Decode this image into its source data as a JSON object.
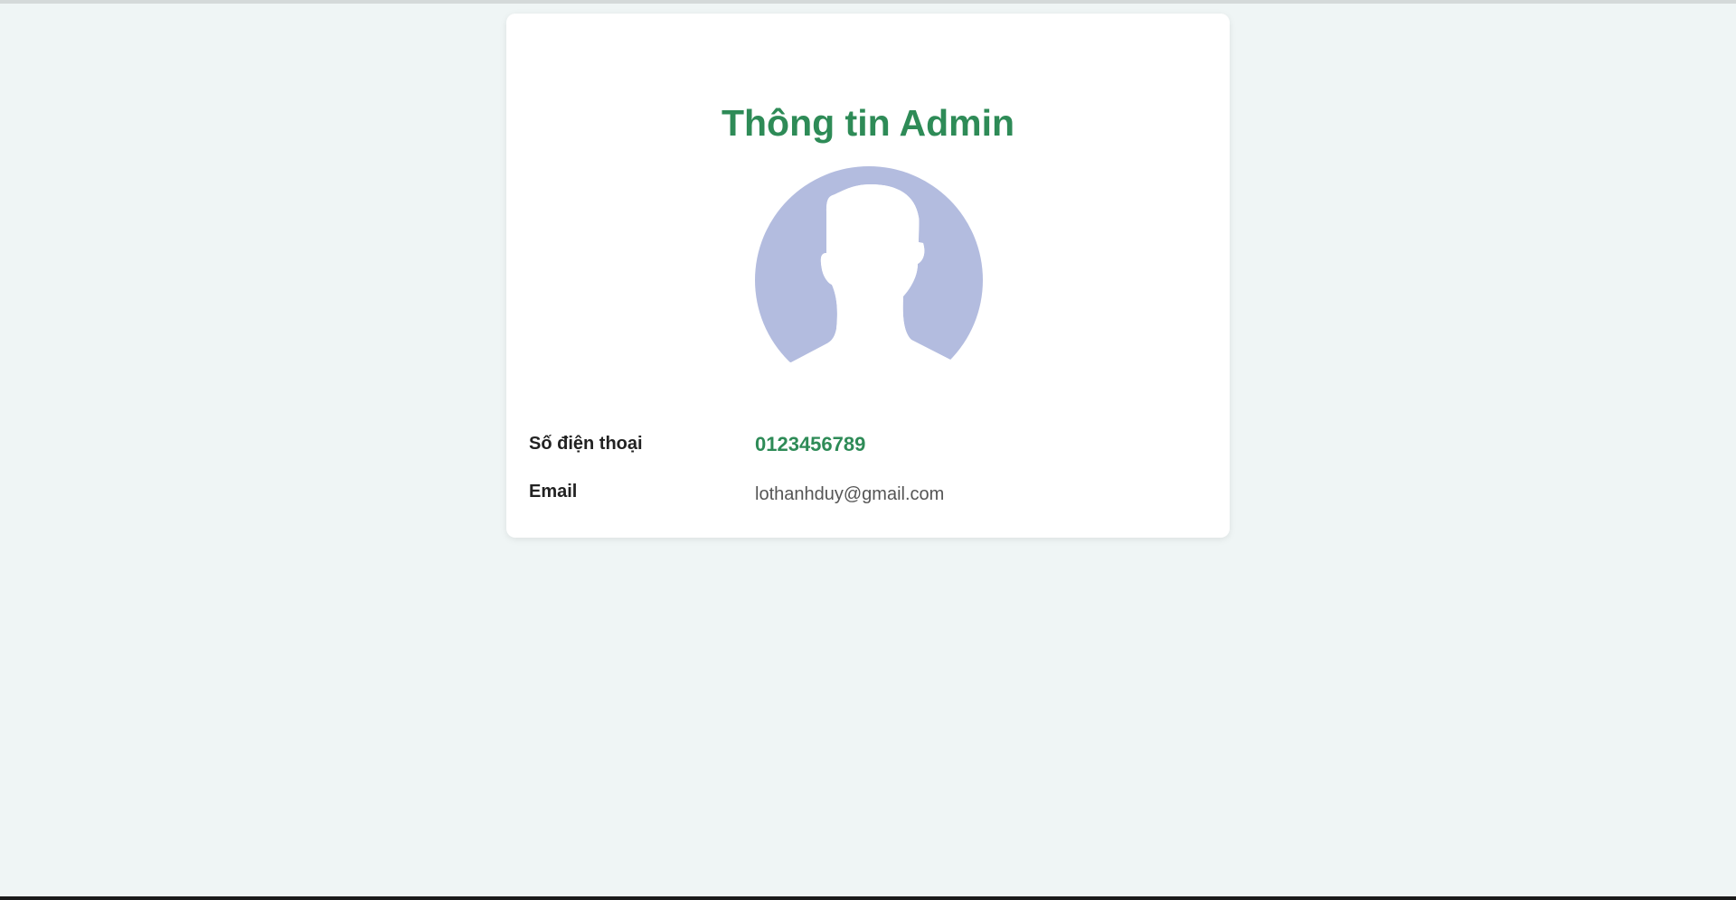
{
  "profile": {
    "title": "Thông tin Admin",
    "avatar_icon": "user-silhouette-icon",
    "fields": {
      "phone_label": "Số điện thoại",
      "phone_value": "0123456789",
      "email_label": "Email",
      "email_value": "lothanhduy@gmail.com"
    }
  },
  "colors": {
    "accent": "#2e8b57",
    "background": "#eff5f5",
    "avatar": "#b3bcdf"
  }
}
